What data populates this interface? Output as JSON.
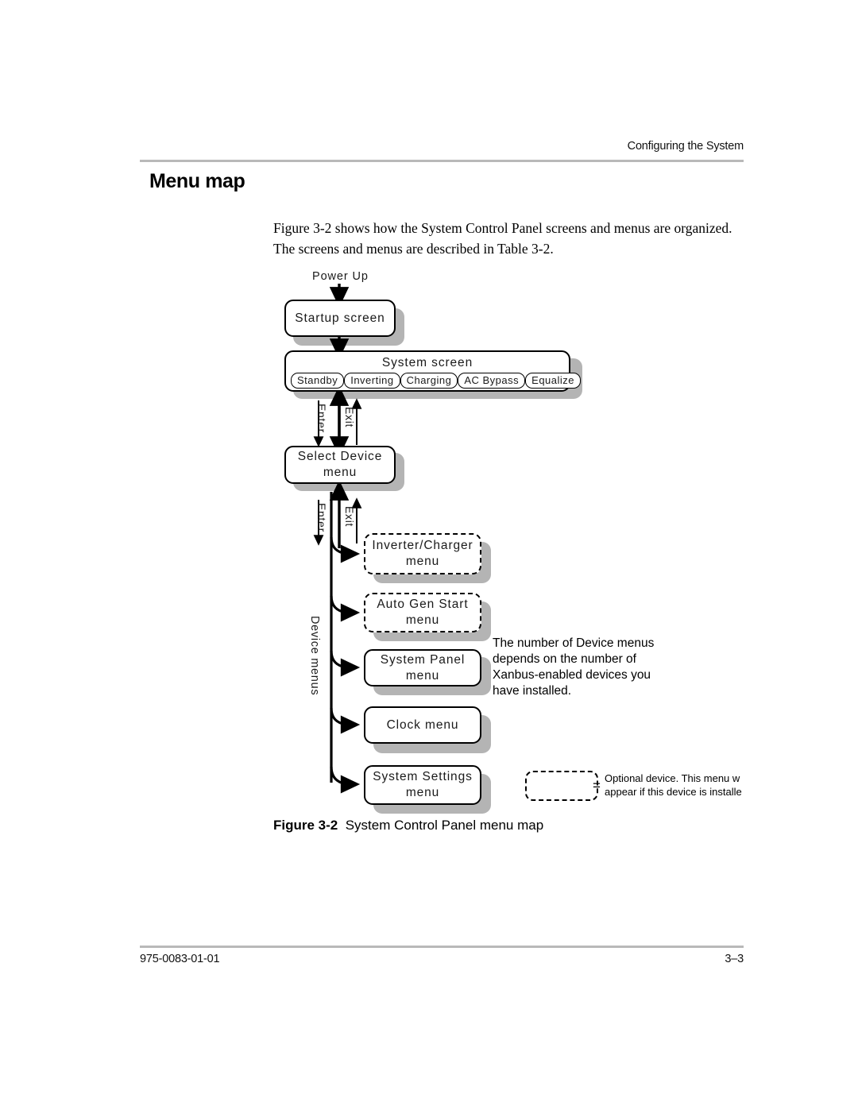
{
  "page": {
    "running_head": "Configuring the System",
    "section_title": "Menu map",
    "intro_paragraph": "Figure 3-2 shows how the System Control Panel screens and menus are organized. The screens and menus are described in Table 3-2.",
    "figure_caption_number": "Figure 3-2",
    "figure_caption_text": "System Control Panel menu map",
    "footer_left": "975-0083-01-01",
    "footer_right": "3–3"
  },
  "diagram": {
    "power_up_label": "Power Up",
    "startup_screen": "Startup screen",
    "system_screen": {
      "title": "System screen",
      "states": [
        "Standby",
        "Inverting",
        "Charging",
        "AC Bypass",
        "Equalize"
      ]
    },
    "select_device_menu": "Select Device\nmenu",
    "select_device_menu_line1": "Select Device",
    "select_device_menu_line2": "menu",
    "transitions": [
      {
        "enter": "Enter",
        "exit": "Exit"
      },
      {
        "enter": "Enter",
        "exit": "Exit"
      }
    ],
    "device_menus_label": "Device menus",
    "device_menus": [
      {
        "line1": "Inverter/Charger",
        "line2": "menu",
        "optional": true
      },
      {
        "line1": "Auto Gen Start menu",
        "line2": "",
        "optional": true
      },
      {
        "line1": "System Panel menu",
        "line2": "",
        "optional": false
      },
      {
        "line1": "Clock menu",
        "line2": "",
        "optional": false
      },
      {
        "line1": "System Settings",
        "line2": "menu",
        "optional": false
      }
    ],
    "annotation": "The number of Device menus depends on the number of Xanbus-enabled devices you have installed.",
    "legend": {
      "equals": "=",
      "line1": "Optional device. This menu w",
      "line2": "appear if this device is installe"
    }
  },
  "colors": {
    "shadow": "#b4b4b4",
    "rule": "#b9b9b9",
    "ink": "#000000"
  }
}
